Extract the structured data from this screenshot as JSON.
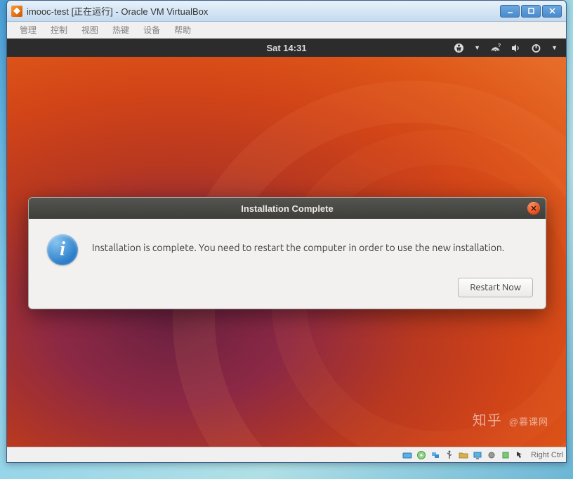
{
  "window": {
    "title": "imooc-test [正在运行] - Oracle VM VirtualBox"
  },
  "vbox_menu": {
    "items": [
      "管理",
      "控制",
      "视图",
      "热键",
      "设备",
      "帮助"
    ]
  },
  "ubuntu_topbar": {
    "clock": "Sat 14:31"
  },
  "dialog": {
    "title": "Installation Complete",
    "message": "Installation is complete. You need to restart the computer in order to use the new installation.",
    "restart_label": "Restart Now"
  },
  "statusbar": {
    "host_key": "Right Ctrl"
  },
  "watermark": {
    "main": "知乎",
    "sub": "@慕课网"
  }
}
